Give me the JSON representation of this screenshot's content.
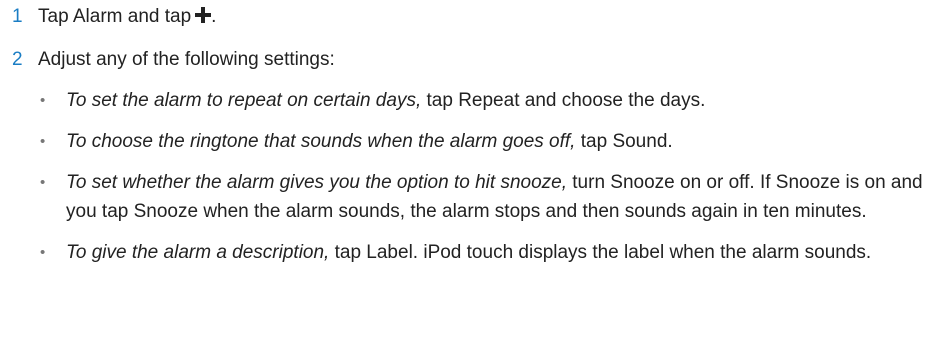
{
  "steps": [
    {
      "number": "1",
      "text": "Tap Alarm and tap",
      "icon": "plus-icon",
      "suffix": "."
    },
    {
      "number": "2",
      "text": "Adjust any of the following settings:"
    }
  ],
  "bullets": [
    {
      "italic": "To set the alarm to repeat on certain days,",
      "text": " tap Repeat and choose the days."
    },
    {
      "italic": "To choose the ringtone that sounds when the alarm goes off,",
      "text": " tap Sound."
    },
    {
      "italic": "To set whether the alarm gives you the option to hit snooze,",
      "text": " turn Snooze on or off. If Snooze is on and you tap Snooze when the alarm sounds, the alarm stops and then sounds again in ten minutes."
    },
    {
      "italic": "To give the alarm a description,",
      "text": " tap Label. iPod touch displays the label when the alarm sounds."
    }
  ],
  "bullet_marker": "•",
  "colors": {
    "step_number": "#1a7dc4",
    "text": "#222222",
    "bullet": "#777777"
  }
}
